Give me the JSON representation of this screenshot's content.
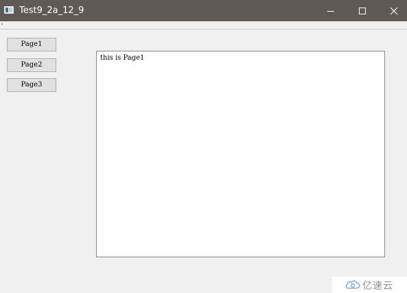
{
  "window": {
    "title": "Test9_2a_12_9",
    "controls": {
      "minimize_icon": "minimize-icon",
      "maximize_icon": "maximize-icon",
      "close_icon": "close-icon"
    },
    "titlebar_color": "#5f5a55"
  },
  "sidebar": {
    "buttons": [
      {
        "label": "Page1"
      },
      {
        "label": "Page2"
      },
      {
        "label": "Page3"
      }
    ]
  },
  "content": {
    "text": "this is Page1"
  },
  "watermark": {
    "text": "亿速云",
    "icon": "cloud-logo-icon"
  }
}
